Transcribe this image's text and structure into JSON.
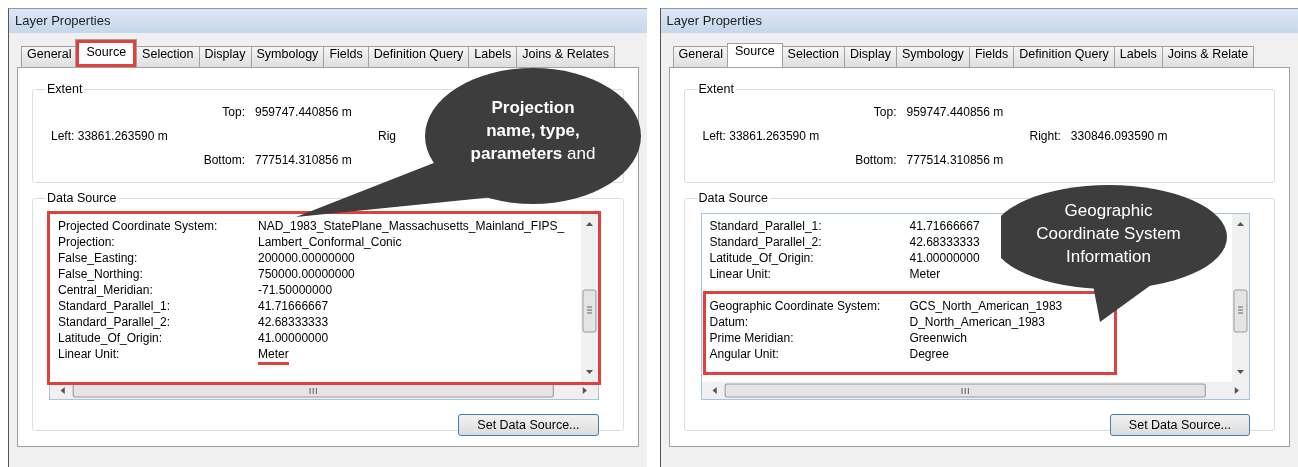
{
  "dialogs": [
    {
      "title": "Layer Properties",
      "tabs": [
        {
          "label": "General",
          "selected": false,
          "highlighted": false
        },
        {
          "label": "Source",
          "selected": true,
          "highlighted": true
        },
        {
          "label": "Selection",
          "selected": false,
          "highlighted": false
        },
        {
          "label": "Display",
          "selected": false,
          "highlighted": false
        },
        {
          "label": "Symbology",
          "selected": false,
          "highlighted": false
        },
        {
          "label": "Fields",
          "selected": false,
          "highlighted": false
        },
        {
          "label": "Definition Query",
          "selected": false,
          "highlighted": false
        },
        {
          "label": "Labels",
          "selected": false,
          "highlighted": false
        },
        {
          "label": "Joins & Relates",
          "selected": false,
          "highlighted": false
        }
      ],
      "extent": {
        "title": "Extent",
        "top_label": "Top:",
        "top_value": "959747.440856 m",
        "left_label": "Left:",
        "left_value": "33861.263590 m",
        "right_label": "Rig",
        "bottom_label": "Bottom:",
        "bottom_value": "777514.310856 m"
      },
      "data_source": {
        "title": "Data Source",
        "highlighted": true,
        "groups": [
          {
            "highlighted": false,
            "rows": [
              {
                "label": "Projected Coordinate System:",
                "value": "NAD_1983_StatePlane_Massachusetts_Mainland_FIPS_",
                "underlined": false
              },
              {
                "label": "Projection:",
                "value": "Lambert_Conformal_Conic",
                "underlined": false
              },
              {
                "label": "False_Easting:",
                "value": "200000.00000000",
                "underlined": false
              },
              {
                "label": "False_Northing:",
                "value": "750000.00000000",
                "underlined": false
              },
              {
                "label": "Central_Meridian:",
                "value": "-71.50000000",
                "underlined": false
              },
              {
                "label": "Standard_Parallel_1:",
                "value": "41.71666667",
                "underlined": false
              },
              {
                "label": "Standard_Parallel_2:",
                "value": "42.68333333",
                "underlined": false
              },
              {
                "label": "Latitude_Of_Origin:",
                "value": "41.00000000",
                "underlined": false
              },
              {
                "label": "Linear Unit:",
                "value": "Meter",
                "underlined": true
              }
            ]
          }
        ]
      },
      "button": "Set Data Source...",
      "callout": {
        "kind": "projection",
        "lines": [
          "**Projection**",
          "**name, type,**",
          "**parameters**  and"
        ]
      }
    },
    {
      "title": "Layer Properties",
      "tabs": [
        {
          "label": "General",
          "selected": false,
          "highlighted": false
        },
        {
          "label": "Source",
          "selected": true,
          "highlighted": false
        },
        {
          "label": "Selection",
          "selected": false,
          "highlighted": false
        },
        {
          "label": "Display",
          "selected": false,
          "highlighted": false
        },
        {
          "label": "Symbology",
          "selected": false,
          "highlighted": false
        },
        {
          "label": "Fields",
          "selected": false,
          "highlighted": false
        },
        {
          "label": "Definition Query",
          "selected": false,
          "highlighted": false
        },
        {
          "label": "Labels",
          "selected": false,
          "highlighted": false
        },
        {
          "label": "Joins & Relate",
          "selected": false,
          "highlighted": false
        }
      ],
      "extent": {
        "title": "Extent",
        "top_label": "Top:",
        "top_value": "959747.440856 m",
        "left_label": "Left:",
        "left_value": "33861.263590 m",
        "right_label": "Right:",
        "right_value": "330846.093590 m",
        "bottom_label": "Bottom:",
        "bottom_value": "777514.310856 m"
      },
      "data_source": {
        "title": "Data Source",
        "highlighted": false,
        "groups": [
          {
            "highlighted": false,
            "rows": [
              {
                "label": "Standard_Parallel_1:",
                "value": "41.71666667",
                "underlined": false
              },
              {
                "label": "Standard_Parallel_2:",
                "value": "42.68333333",
                "underlined": false
              },
              {
                "label": "Latitude_Of_Origin:",
                "value": "41.00000000",
                "underlined": false
              },
              {
                "label": "Linear Unit:",
                "value": "Meter",
                "underlined": false
              }
            ]
          },
          {
            "highlighted": true,
            "rows": [
              {
                "label": "Geographic Coordinate System:",
                "value": "GCS_North_American_1983",
                "underlined": false
              },
              {
                "label": "Datum:",
                "value": "D_North_American_1983",
                "underlined": false
              },
              {
                "label": "Prime Meridian:",
                "value": "Greenwich",
                "underlined": false
              },
              {
                "label": "Angular Unit:",
                "value": "Degree",
                "underlined": false
              }
            ]
          }
        ]
      },
      "button": "Set Data Source...",
      "callout": {
        "kind": "geographic",
        "lines": [
          "Geographic",
          "Coordinate System",
          "Information"
        ]
      }
    }
  ]
}
